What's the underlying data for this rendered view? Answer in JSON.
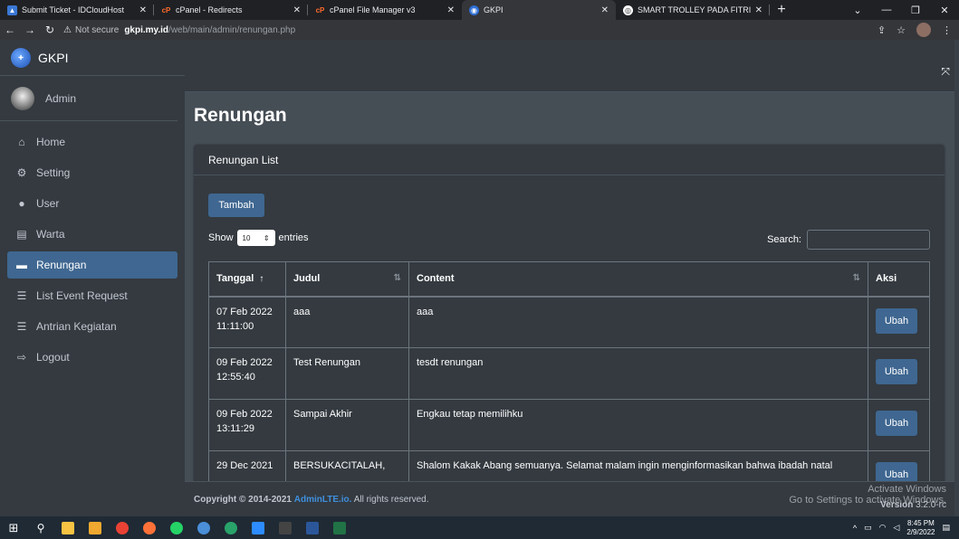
{
  "browser": {
    "tabs": [
      {
        "title": "Submit Ticket - IDCloudHost",
        "active": false
      },
      {
        "title": "cPanel - Redirects",
        "active": false
      },
      {
        "title": "cPanel File Manager v3",
        "active": false
      },
      {
        "title": "GKPI",
        "active": true
      },
      {
        "title": "SMART TROLLEY PADA FITRI",
        "active": false
      }
    ],
    "new_tab": "+",
    "not_secure": "Not secure",
    "url_host": "gkpi.my.id",
    "url_path": "/web/main/admin/renungan.php"
  },
  "brand": {
    "name": "GKPI"
  },
  "user": {
    "name": "Admin"
  },
  "sidebar": {
    "items": [
      {
        "label": "Home",
        "icon": "home-icon",
        "glyph": "⌂",
        "active": false
      },
      {
        "label": "Setting",
        "icon": "cogs-icon",
        "glyph": "⚙",
        "active": false
      },
      {
        "label": "User",
        "icon": "user-icon",
        "glyph": "●",
        "active": false
      },
      {
        "label": "Warta",
        "icon": "newspaper-icon",
        "glyph": "▤",
        "active": false
      },
      {
        "label": "Renungan",
        "icon": "book-icon",
        "glyph": "▬",
        "active": true
      },
      {
        "label": "List Event Request",
        "icon": "list-icon",
        "glyph": "☰",
        "active": false
      },
      {
        "label": "Antrian Kegiatan",
        "icon": "list-icon",
        "glyph": "☰",
        "active": false
      },
      {
        "label": "Logout",
        "icon": "sign-out-icon",
        "glyph": "⇨",
        "active": false
      }
    ]
  },
  "page": {
    "title": "Renungan",
    "card_title": "Renungan List",
    "add_button": "Tambah",
    "show_label": "Show",
    "entries_value": "10",
    "entries_label": "entries",
    "search_label": "Search:"
  },
  "table": {
    "headers": [
      "Tanggal",
      "Judul",
      "Content",
      "Aksi"
    ],
    "rows": [
      {
        "tanggal": "07 Feb 2022\n11:11:00",
        "judul": "aaa",
        "content": "aaa",
        "aksi": "Ubah"
      },
      {
        "tanggal": "09 Feb 2022\n12:55:40",
        "judul": "Test Renungan",
        "content": "tesdt renungan",
        "aksi": "Ubah"
      },
      {
        "tanggal": "09 Feb 2022\n13:11:29",
        "judul": "Sampai Akhir",
        "content": "Engkau tetap memilihku",
        "aksi": "Ubah"
      },
      {
        "tanggal": "29 Dec 2021",
        "judul": "BERSUKACITALAH,",
        "content": "Shalom Kakak Abang semuanya. Selamat malam ingin menginformasikan bahwa ibadah natal",
        "aksi": "Ubah"
      }
    ]
  },
  "footer": {
    "copyright": "Copyright © 2014-2021",
    "link": "AdminLTE.io.",
    "rights": "All rights reserved.",
    "version_label": "Version",
    "version": "3.2.0-rc"
  },
  "watermark": {
    "line1": "Activate Windows",
    "line2": "Go to Settings to activate Windows."
  },
  "taskbar": {
    "time": "8:45 PM",
    "date": "2/9/2022"
  },
  "colors": {
    "accent": "#3f6791",
    "sidebar_bg": "#343a40",
    "content_bg": "#454d55"
  }
}
